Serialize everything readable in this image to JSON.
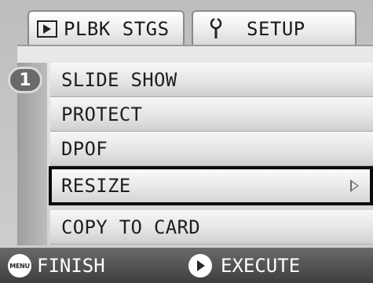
{
  "tabs": [
    {
      "label": "PLBK STGS",
      "icon": "playback-icon",
      "active": true
    },
    {
      "label": "SETUP",
      "icon": "wrench-icon",
      "active": false
    }
  ],
  "page_number": "1",
  "menu": {
    "items": [
      {
        "label": "SLIDE SHOW"
      },
      {
        "label": "PROTECT"
      },
      {
        "label": "DPOF"
      },
      {
        "label": "RESIZE",
        "selected": true
      },
      {
        "label": "COPY TO CARD"
      }
    ]
  },
  "footer": {
    "menu_button": "MENU",
    "finish_label": "FINISH",
    "execute_label": "EXECUTE"
  }
}
